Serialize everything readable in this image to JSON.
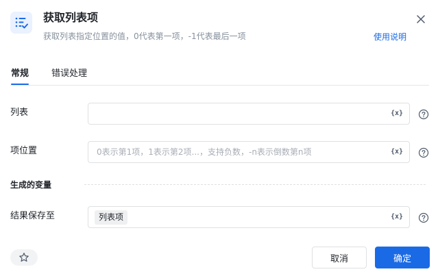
{
  "dialog": {
    "title": "获取列表项",
    "subtitle": "获取列表指定位置的值，0代表第一项，-1代表最后一项",
    "help_link": "使用说明",
    "icon": "list-check-icon",
    "accent_color": "#1a6ae6"
  },
  "tabs": [
    {
      "label": "常规",
      "active": true
    },
    {
      "label": "错误处理",
      "active": false
    }
  ],
  "fields": {
    "list": {
      "label": "列表",
      "value": "",
      "placeholder": "",
      "var_button": "{x}"
    },
    "index": {
      "label": "项位置",
      "value": "",
      "placeholder": "0表示第1项，1表示第2项...，支持负数，-n表示倒数第n项",
      "var_button": "{x}"
    }
  },
  "output_section": {
    "title": "生成的变量"
  },
  "output": {
    "label": "结果保存至",
    "tag": "列表项",
    "var_button": "{x}"
  },
  "footer": {
    "cancel_label": "取消",
    "ok_label": "确定"
  }
}
